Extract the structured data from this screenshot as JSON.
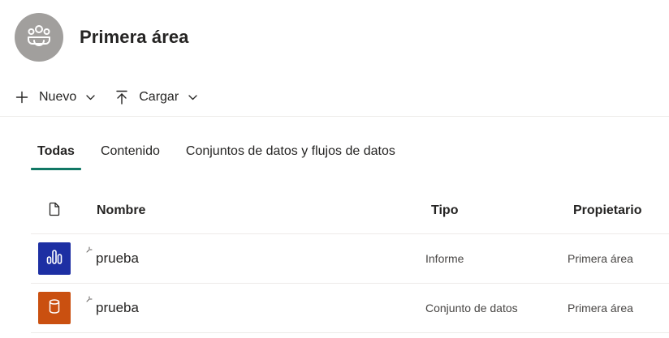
{
  "workspace": {
    "title": "Primera área",
    "avatar_icon": "people-group-icon",
    "avatar_color": "#a19f9d"
  },
  "toolbar": {
    "new_label": "Nuevo",
    "upload_label": "Cargar"
  },
  "tabs": [
    {
      "label": "Todas",
      "active": true
    },
    {
      "label": "Contenido",
      "active": false
    },
    {
      "label": "Conjuntos de datos y flujos de datos",
      "active": false
    }
  ],
  "accent_color": "#117865",
  "table": {
    "columns": {
      "icon": "document-icon",
      "name": "Nombre",
      "type": "Tipo",
      "owner": "Propietario"
    },
    "rows": [
      {
        "name": "prueba",
        "type": "Informe",
        "owner": "Primera área",
        "icon": "report-bar-chart-icon",
        "tile_color": "#1d2fa3"
      },
      {
        "name": "prueba",
        "type": "Conjunto de datos",
        "owner": "Primera área",
        "icon": "dataset-cylinder-icon",
        "tile_color": "#ca5010"
      }
    ]
  }
}
